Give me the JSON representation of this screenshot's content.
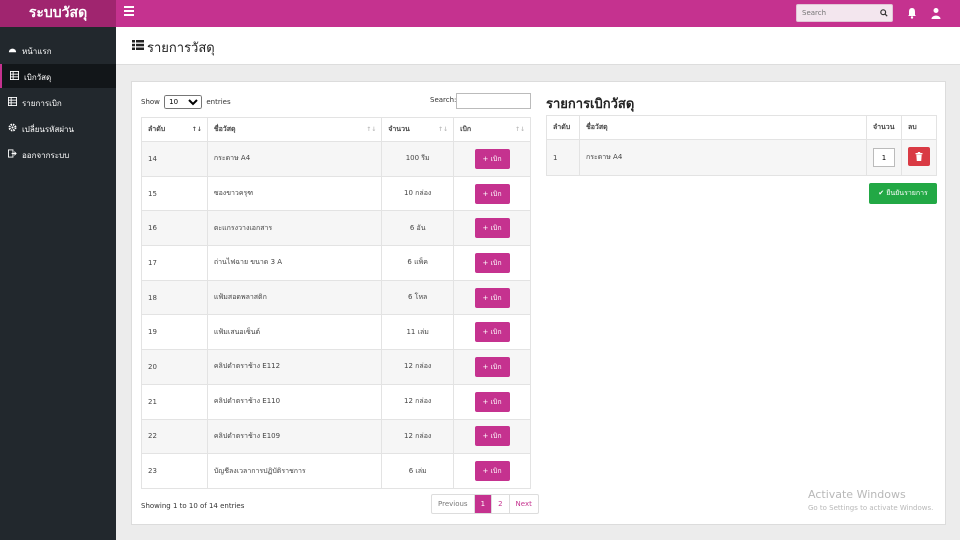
{
  "app": {
    "brand": "ระบบวัสดุ"
  },
  "topbar": {
    "search_placeholder": "Search"
  },
  "sidebar": {
    "items": [
      {
        "label": "หน้าแรก",
        "icon": "dashboard-icon"
      },
      {
        "label": "เบิกวัสดุ",
        "icon": "table-icon"
      },
      {
        "label": "รายการเบิก",
        "icon": "table-icon"
      },
      {
        "label": "เปลี่ยนรหัสผ่าน",
        "icon": "gear-icon"
      },
      {
        "label": "ออกจากระบบ",
        "icon": "sign-out-icon"
      }
    ]
  },
  "page": {
    "title": "รายการวัสดุ"
  },
  "left": {
    "show_label": "Show",
    "show_value": "10",
    "entries_label": "entries",
    "search_label": "Search:",
    "headers": [
      "ลำดับ",
      "ชื่อวัสดุ",
      "จำนวน",
      "เบิก"
    ],
    "pick_label": "+ เบิก",
    "rows": [
      {
        "no": "14",
        "name": "กระดาษ A4",
        "qty": "100 รีม"
      },
      {
        "no": "15",
        "name": "ซองขาวครุฑ",
        "qty": "10 กล่อง"
      },
      {
        "no": "16",
        "name": "ตะแกรงวางเอกสาร",
        "qty": "6 อัน"
      },
      {
        "no": "17",
        "name": "ถ่านไฟฉาย ขนาด 3 A",
        "qty": "6 แพ็ค"
      },
      {
        "no": "18",
        "name": "แฟ้มสอดพลาสติก",
        "qty": "6 โหล"
      },
      {
        "no": "19",
        "name": "แฟ้มเสนอเซ็นต์",
        "qty": "11 เล่ม"
      },
      {
        "no": "20",
        "name": "คลิปดำตราช้าง E112",
        "qty": "12 กล่อง"
      },
      {
        "no": "21",
        "name": "คลิปดำตราช้าง E110",
        "qty": "12 กล่อง"
      },
      {
        "no": "22",
        "name": "คลิปดำตราช้าง E109",
        "qty": "12 กล่อง"
      },
      {
        "no": "23",
        "name": "บัญชีลงเวลาการปฏิบัติราชการ",
        "qty": "6 เล่ม"
      }
    ],
    "info": "Showing 1 to 10 of 14 entries",
    "pager": {
      "prev": "Previous",
      "p1": "1",
      "p2": "2",
      "next": "Next"
    }
  },
  "right": {
    "title": "รายการเบิกวัสดุ",
    "headers": [
      "ลำดับ",
      "ชื่อวัสดุ",
      "จำนวน",
      "ลบ"
    ],
    "rows": [
      {
        "no": "1",
        "name": "กระดาษ A4",
        "qty": "1"
      }
    ],
    "confirm_label": "ยืนยันรายการ"
  },
  "watermark": {
    "line1": "Activate Windows",
    "line2": "Go to Settings to activate Windows."
  },
  "colors": {
    "brand": "#c5328f",
    "sidebar": "#22282d",
    "success": "#22a845",
    "danger": "#d93a44"
  }
}
